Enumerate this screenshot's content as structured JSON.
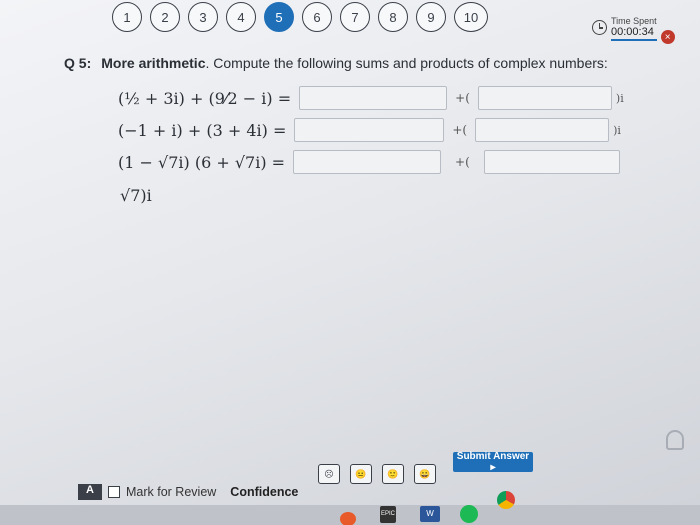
{
  "nav": {
    "questions": [
      "1",
      "2",
      "3",
      "4",
      "5",
      "6",
      "7",
      "8",
      "9",
      "10"
    ],
    "active_index": 4
  },
  "timer": {
    "label": "Time Spent",
    "value": "00:00:34",
    "close": "×"
  },
  "question": {
    "number": "Q 5:",
    "title": "More arithmetic",
    "instruction": ". Compute the following sums and products of complex numbers:",
    "rows": [
      {
        "expr": "(½ + 3i) + (9⁄2 − i) =",
        "plus": "+(",
        "i_suffix": ")i"
      },
      {
        "expr": "(−1 + i) + (3 + 4i) =",
        "plus": "+(",
        "i_suffix": ")i"
      },
      {
        "expr": "(1 − √7i) (6 + √7i) =",
        "plus": "+(",
        "i_suffix": ""
      }
    ],
    "overflow_text": "√7)i"
  },
  "footer": {
    "submit_label": "Submit Answer ▸",
    "mark_for_review": "Mark for Review",
    "confidence": "Confidence",
    "faces": [
      "☹",
      "😐",
      "🙂",
      "😀"
    ]
  },
  "taskbar": {
    "epic": "EPIC",
    "word": "W"
  },
  "colors": {
    "accent": "#1f6fb8",
    "close": "#c0392b"
  }
}
